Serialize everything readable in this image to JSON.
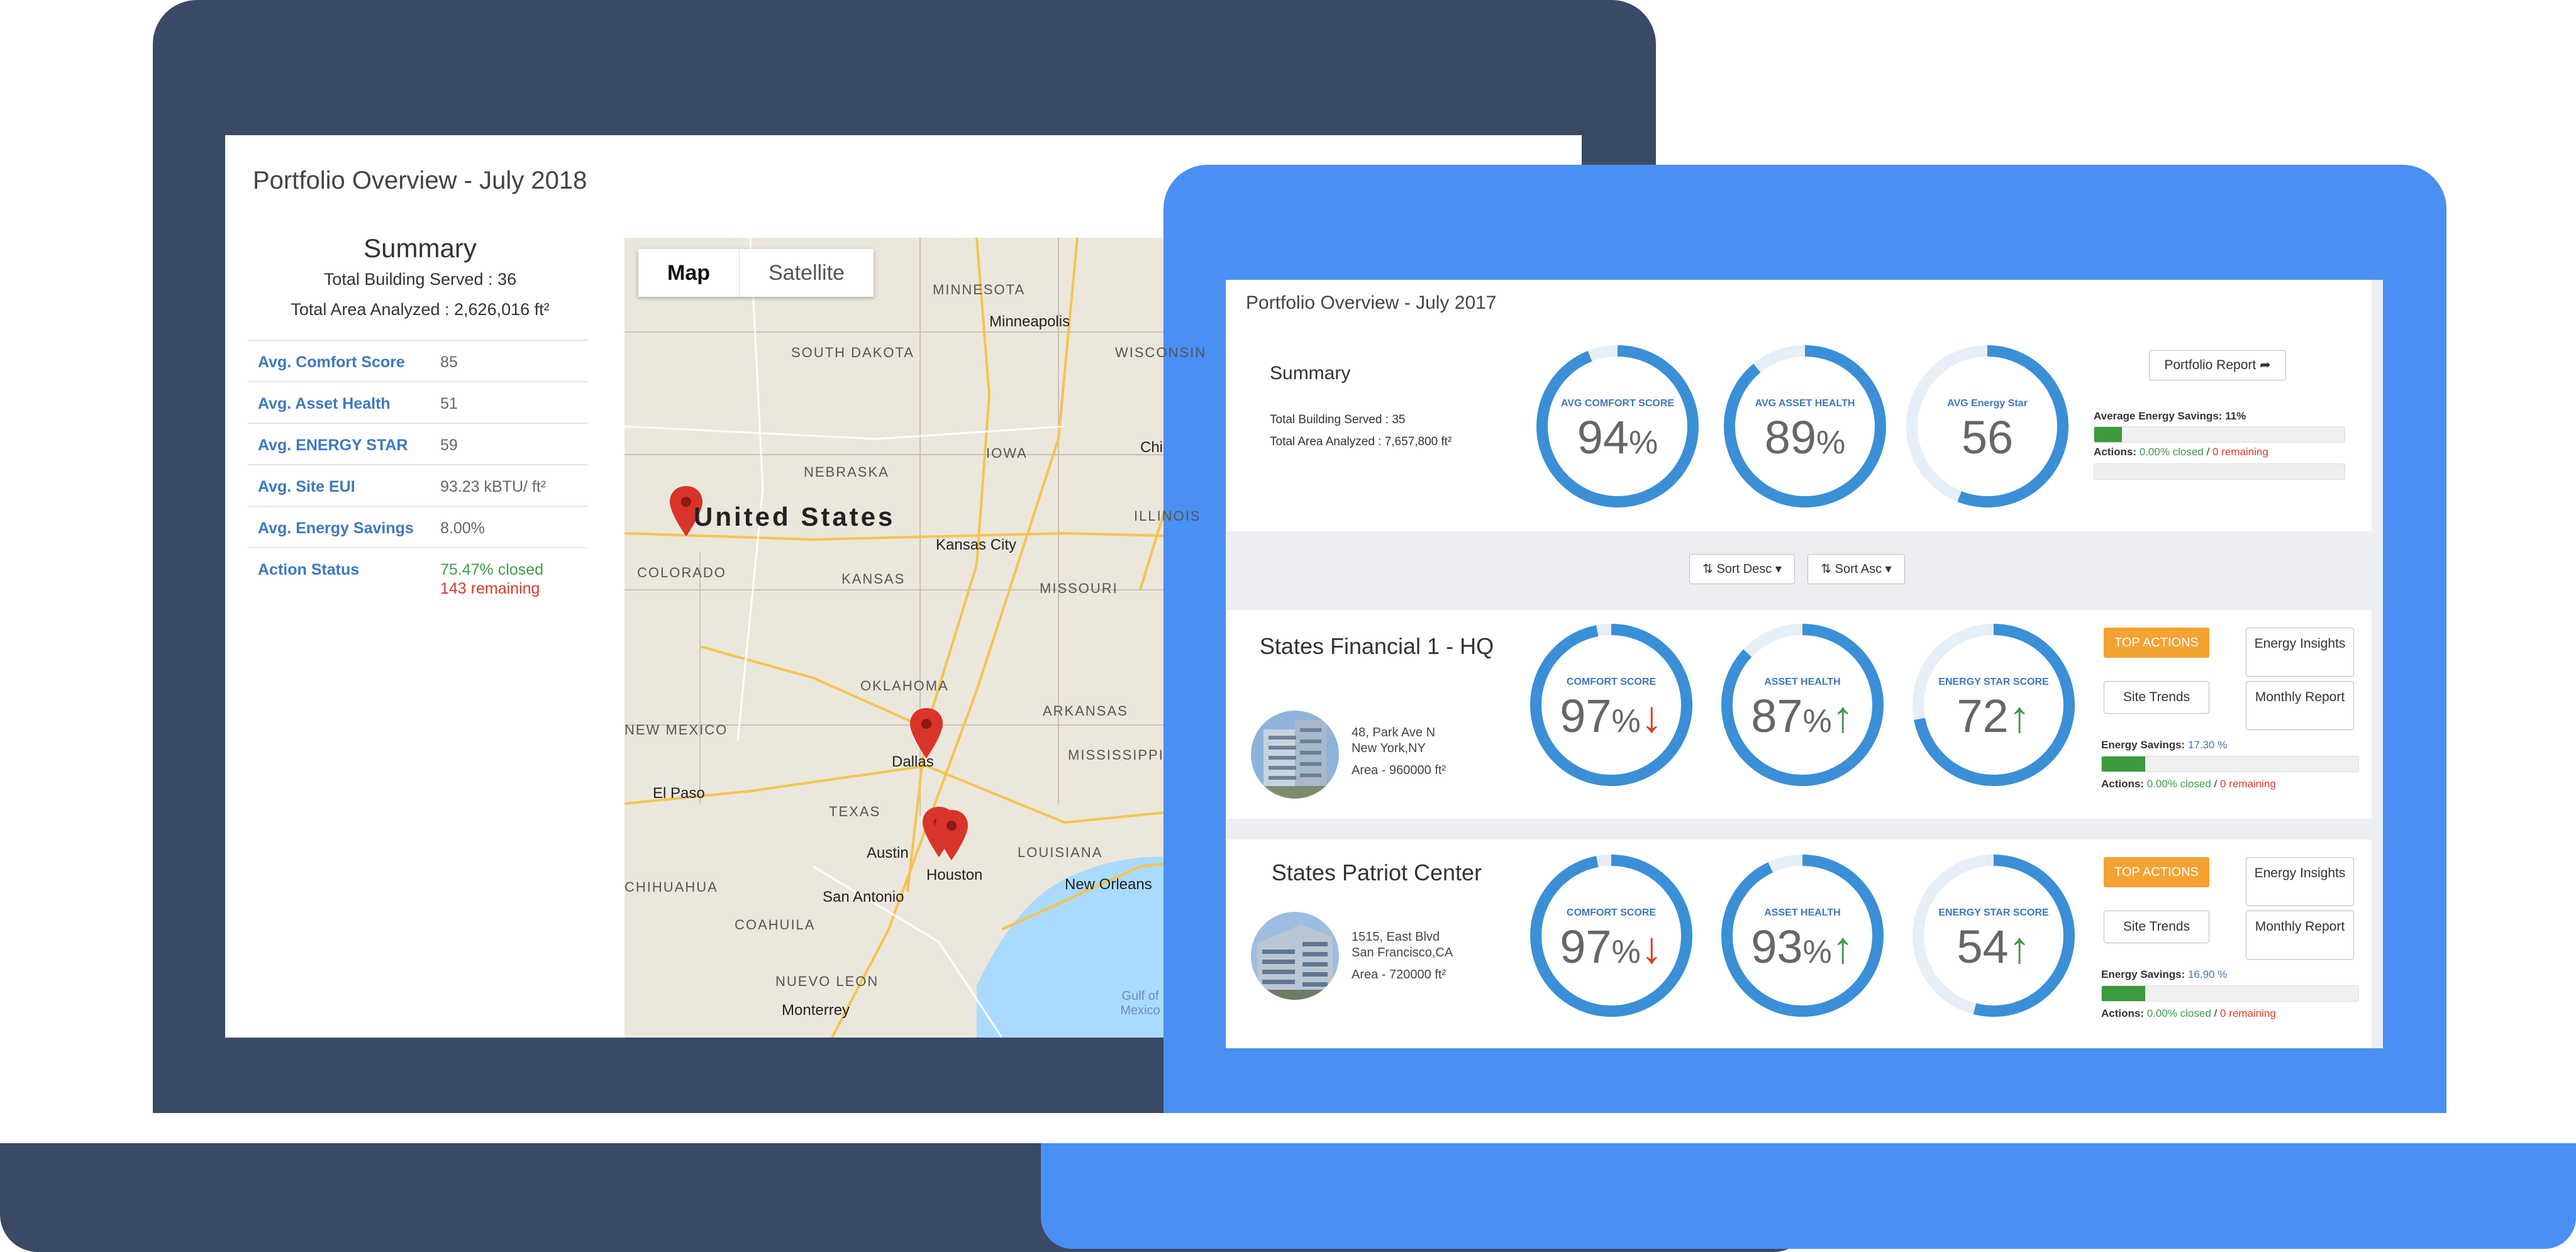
{
  "dark": {
    "title": "Portfolio Overview - July 2018",
    "summary": {
      "title": "Summary",
      "line1": "Total Building Served : 36",
      "line2": "Total Area Analyzed : 2,626,016 ft²",
      "rows": [
        {
          "key": "Avg. Comfort Score",
          "value": "85"
        },
        {
          "key": "Avg. Asset Health",
          "value": "51"
        },
        {
          "key": "Avg. ENERGY STAR",
          "value": "59"
        },
        {
          "key": "Avg. Site EUI",
          "value": "93.23 kBTU/ ft²"
        },
        {
          "key": "Avg. Energy Savings",
          "value": "8.00%"
        }
      ],
      "action": {
        "key": "Action Status",
        "closed": "75.47% closed",
        "remaining": "143 remaining"
      }
    },
    "map": {
      "toggle_map": "Map",
      "toggle_satellite": "Satellite",
      "country": "United States",
      "states": [
        "MINNESOTA",
        "WISCONSIN",
        "SOUTH DAKOTA",
        "IOWA",
        "NEBRASKA",
        "ILLINOIS",
        "COLORADO",
        "KANSAS",
        "MISSOURI",
        "OKLAHOMA",
        "ARKANSAS",
        "NEW MEXICO",
        "MISSISSIPPI",
        "TEXAS",
        "LOUISIANA",
        "CHIHUAHUA",
        "COAHUILA",
        "NUEVO LEON"
      ],
      "cities": [
        "Minneapolis",
        "Chi",
        "Kansas City",
        "Dallas",
        "El Paso",
        "Austin",
        "Houston",
        "San Antonio",
        "New Orleans",
        "Monterrey"
      ],
      "gulf": "Gulf of Mexico"
    }
  },
  "blue": {
    "title": "Portfolio Overview - July 2017",
    "summary": {
      "title": "Summary",
      "line1": "Total Building Served : 35",
      "line2": "Total Area Analyzed : 7,657,800 ft²",
      "gauges": [
        {
          "label": "AVG COMFORT SCORE",
          "value": "94",
          "unit": "%",
          "fraction": 0.94
        },
        {
          "label": "AVG ASSET HEALTH",
          "value": "89",
          "unit": "%",
          "fraction": 0.89
        },
        {
          "label": "AVG Energy Star",
          "value": "56",
          "unit": "",
          "fraction": 0.56
        }
      ],
      "report_button": "Portfolio Report",
      "savings_label": "Average Energy Savings: 11%",
      "savings_fraction": 0.11,
      "actions_label": "Actions:",
      "actions_closed": "0.00% closed",
      "actions_sep": " / ",
      "actions_remaining": "0 remaining"
    },
    "sort_desc": "Sort Desc",
    "sort_asc": "Sort Asc",
    "buildings": [
      {
        "name": "States Financial 1 - HQ",
        "addr1": "48, Park Ave N",
        "addr2": "New York,NY",
        "area": "Area - 960000 ft²",
        "gauges": [
          {
            "label": "COMFORT SCORE",
            "value": "97",
            "unit": "%",
            "fraction": 0.97,
            "trend": "down"
          },
          {
            "label": "ASSET HEALTH",
            "value": "87",
            "unit": "%",
            "fraction": 0.87,
            "trend": "up"
          },
          {
            "label": "ENERGY STAR SCORE",
            "value": "72",
            "unit": "",
            "fraction": 0.72,
            "trend": "up"
          }
        ],
        "top_actions": "TOP ACTIONS",
        "energy_insights": "Energy Insights",
        "site_trends": "Site Trends",
        "monthly_report": "Monthly Report",
        "savings_label": "Energy Savings:",
        "savings_value": "17.30 %",
        "savings_fraction": 0.17,
        "actions_label": "Actions:",
        "actions_closed": "0.00% closed",
        "actions_remaining": "0 remaining"
      },
      {
        "name": "States Patriot Center",
        "addr1": "1515, East Blvd",
        "addr2": "San Francisco,CA",
        "area": "Area - 720000 ft²",
        "gauges": [
          {
            "label": "COMFORT SCORE",
            "value": "97",
            "unit": "%",
            "fraction": 0.97,
            "trend": "down"
          },
          {
            "label": "ASSET HEALTH",
            "value": "93",
            "unit": "%",
            "fraction": 0.93,
            "trend": "up"
          },
          {
            "label": "ENERGY STAR SCORE",
            "value": "54",
            "unit": "",
            "fraction": 0.54,
            "trend": "up"
          }
        ],
        "top_actions": "TOP ACTIONS",
        "energy_insights": "Energy Insights",
        "site_trends": "Site Trends",
        "monthly_report": "Monthly Report",
        "savings_label": "Energy Savings:",
        "savings_value": "16.90 %",
        "savings_fraction": 0.17,
        "actions_label": "Actions:",
        "actions_closed": "0.00% closed",
        "actions_remaining": "0 remaining"
      }
    ]
  },
  "colors": {
    "dark_laptop": "#3a4a66",
    "blue_laptop": "#4a8ff2",
    "gauge_ring": "#3a8fd6",
    "link_blue": "#3e78c0",
    "green": "#3f9a4a",
    "red": "#d93a2b",
    "orange": "#f4a232"
  }
}
